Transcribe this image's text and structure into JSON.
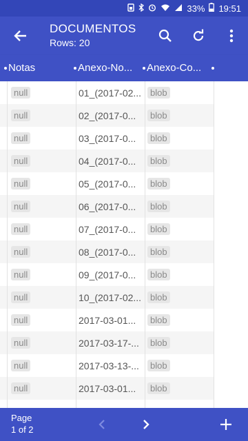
{
  "status_bar": {
    "battery": "33%",
    "time": "19:51"
  },
  "app_bar": {
    "title": "DOCUMENTOS",
    "subtitle": "Rows: 20"
  },
  "columns": [
    "Notas",
    "Anexo-No...",
    "Anexo-Co..."
  ],
  "rows": [
    {
      "notas": "null",
      "anexo_nome": "01_(2017-02...",
      "anexo_conteudo": "blob"
    },
    {
      "notas": "null",
      "anexo_nome": "02_(2017-0...",
      "anexo_conteudo": "blob"
    },
    {
      "notas": "null",
      "anexo_nome": "03_(2017-0...",
      "anexo_conteudo": "blob"
    },
    {
      "notas": "null",
      "anexo_nome": "04_(2017-0...",
      "anexo_conteudo": "blob"
    },
    {
      "notas": "null",
      "anexo_nome": "05_(2017-0...",
      "anexo_conteudo": "blob"
    },
    {
      "notas": "null",
      "anexo_nome": "06_(2017-0...",
      "anexo_conteudo": "blob"
    },
    {
      "notas": "null",
      "anexo_nome": "07_(2017-0...",
      "anexo_conteudo": "blob"
    },
    {
      "notas": "null",
      "anexo_nome": "08_(2017-0...",
      "anexo_conteudo": "blob"
    },
    {
      "notas": "null",
      "anexo_nome": "09_(2017-0...",
      "anexo_conteudo": "blob"
    },
    {
      "notas": "null",
      "anexo_nome": "10_(2017-02...",
      "anexo_conteudo": "blob"
    },
    {
      "notas": "null",
      "anexo_nome": "2017-03-01...",
      "anexo_conteudo": "blob"
    },
    {
      "notas": "null",
      "anexo_nome": "2017-03-17-...",
      "anexo_conteudo": "blob"
    },
    {
      "notas": "null",
      "anexo_nome": "2017-03-13-...",
      "anexo_conteudo": "blob"
    },
    {
      "notas": "null",
      "anexo_nome": "2017-03-01...",
      "anexo_conteudo": "blob"
    }
  ],
  "pager": {
    "page_label": "Page",
    "page_value": "1 of 2"
  },
  "colors": {
    "primary": "#3f51c5",
    "status": "#3346b8",
    "chip": "#e6e6e6"
  },
  "icons": [
    "back-arrow-icon",
    "search-icon",
    "refresh-icon",
    "more-vert-icon",
    "chevron-left-icon",
    "chevron-right-icon",
    "add-icon"
  ]
}
